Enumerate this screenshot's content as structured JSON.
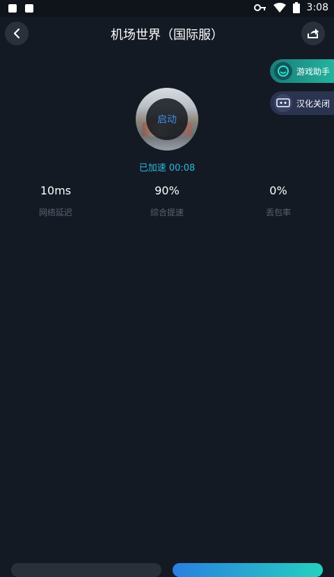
{
  "status_bar": {
    "time": "3:08"
  },
  "header": {
    "title": "机场世界（国际服）"
  },
  "side_buttons": {
    "assistant": "游戏助手",
    "translate": "汉化关闭"
  },
  "game": {
    "start_label": "启动",
    "accel_status": "已加速 00:08"
  },
  "stats": [
    {
      "value": "10ms",
      "label": "网络延迟"
    },
    {
      "value": "90%",
      "label": "综合提速"
    },
    {
      "value": "0%",
      "label": "丢包率"
    }
  ],
  "colors": {
    "background": "#141a24",
    "accent": "#2ab8e0",
    "assistant_gradient": "#24b39e"
  }
}
